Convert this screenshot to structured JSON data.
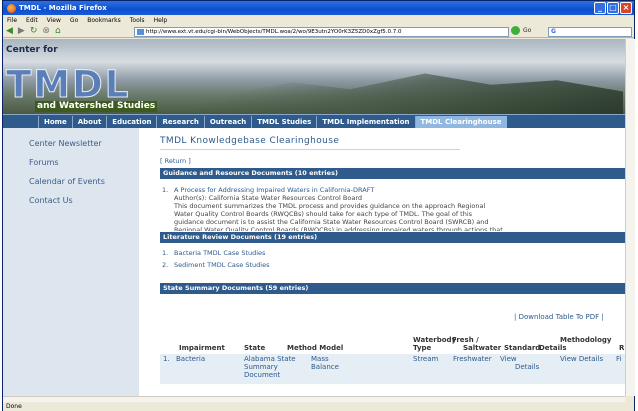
{
  "window": {
    "title": "TMDL - Mozilla Firefox",
    "controls": [
      "_",
      "□",
      "×"
    ]
  },
  "menubar": [
    "File",
    "Edit",
    "View",
    "Go",
    "Bookmarks",
    "Tools",
    "Help"
  ],
  "toolbar": {
    "url": "http://www.ext.vt.edu/cgi-bin/WebObjects/TMDL.woa/2/wo/9E3utn2YO0rK3Z5ZD0xZgf5.0.7.0",
    "go_label": "Go",
    "search_label": "G"
  },
  "banner": {
    "line1": "Center for",
    "logo": "TMDL",
    "subtitle": "and Watershed Studies"
  },
  "topnav": [
    "Home",
    "About",
    "Education",
    "Research",
    "Outreach",
    "TMDL Studies",
    "TMDL Implementation",
    "TMDL Clearinghouse"
  ],
  "sidebar": [
    "Center Newsletter",
    "Forums",
    "Calendar of Events",
    "Contact Us"
  ],
  "page": {
    "title": "TMDL Knowledgebase Clearinghouse",
    "return_link": "[ Return ]",
    "sections": [
      {
        "header": "Guidance and Resource Documents (10 entries)",
        "items": [
          {
            "num": "1.",
            "title": "A Process for Addressing Impaired Waters in California-DRAFT",
            "author": "Author(s): California State Water Resources Control Board",
            "desc1": "This document summarizes the TMDL process and provides guidance on the approach Regional",
            "desc2": "Water Quality Control Boards (RWQCBs) should take for each type of TMDL. The goal of this",
            "desc3": "guidance document is to assist the California State Water Resources Control Board (SWRCB) and",
            "desc4": "Regional Water Quality Control Boards (RWQCBs) in addressing impaired waters through actions that"
          }
        ]
      },
      {
        "header": "Literature Review Documents (19 entries)",
        "items": [
          {
            "num": "1.",
            "title": "Bacteria TMDL Case Studies"
          },
          {
            "num": "2.",
            "title": "Sediment TMDL Case Studies"
          }
        ]
      },
      {
        "header": "State Summary Documents (59 entries)"
      }
    ],
    "download": "| Download Table To PDF |",
    "table": {
      "headers": {
        "impairment": "Impairment",
        "state": "State",
        "method": "Method Model",
        "wb1": "Waterbody",
        "wb2": "Type",
        "fs1": "Fresh /",
        "fs2": "Saltwater",
        "std": "Standard",
        "md1": "Methodology",
        "md2": "Details",
        "r": "R"
      },
      "row": {
        "num": "1.",
        "impairment": "Bacteria",
        "state1": "Alabama State",
        "state2": "Summary",
        "state3": "Document",
        "method1": "Mass",
        "method2": "Balance",
        "waterbody": "Stream",
        "fresh": "Freshwater",
        "std1": "View",
        "std2": "Details",
        "details": "View Details",
        "r": "Fi"
      }
    }
  },
  "status": "Done"
}
